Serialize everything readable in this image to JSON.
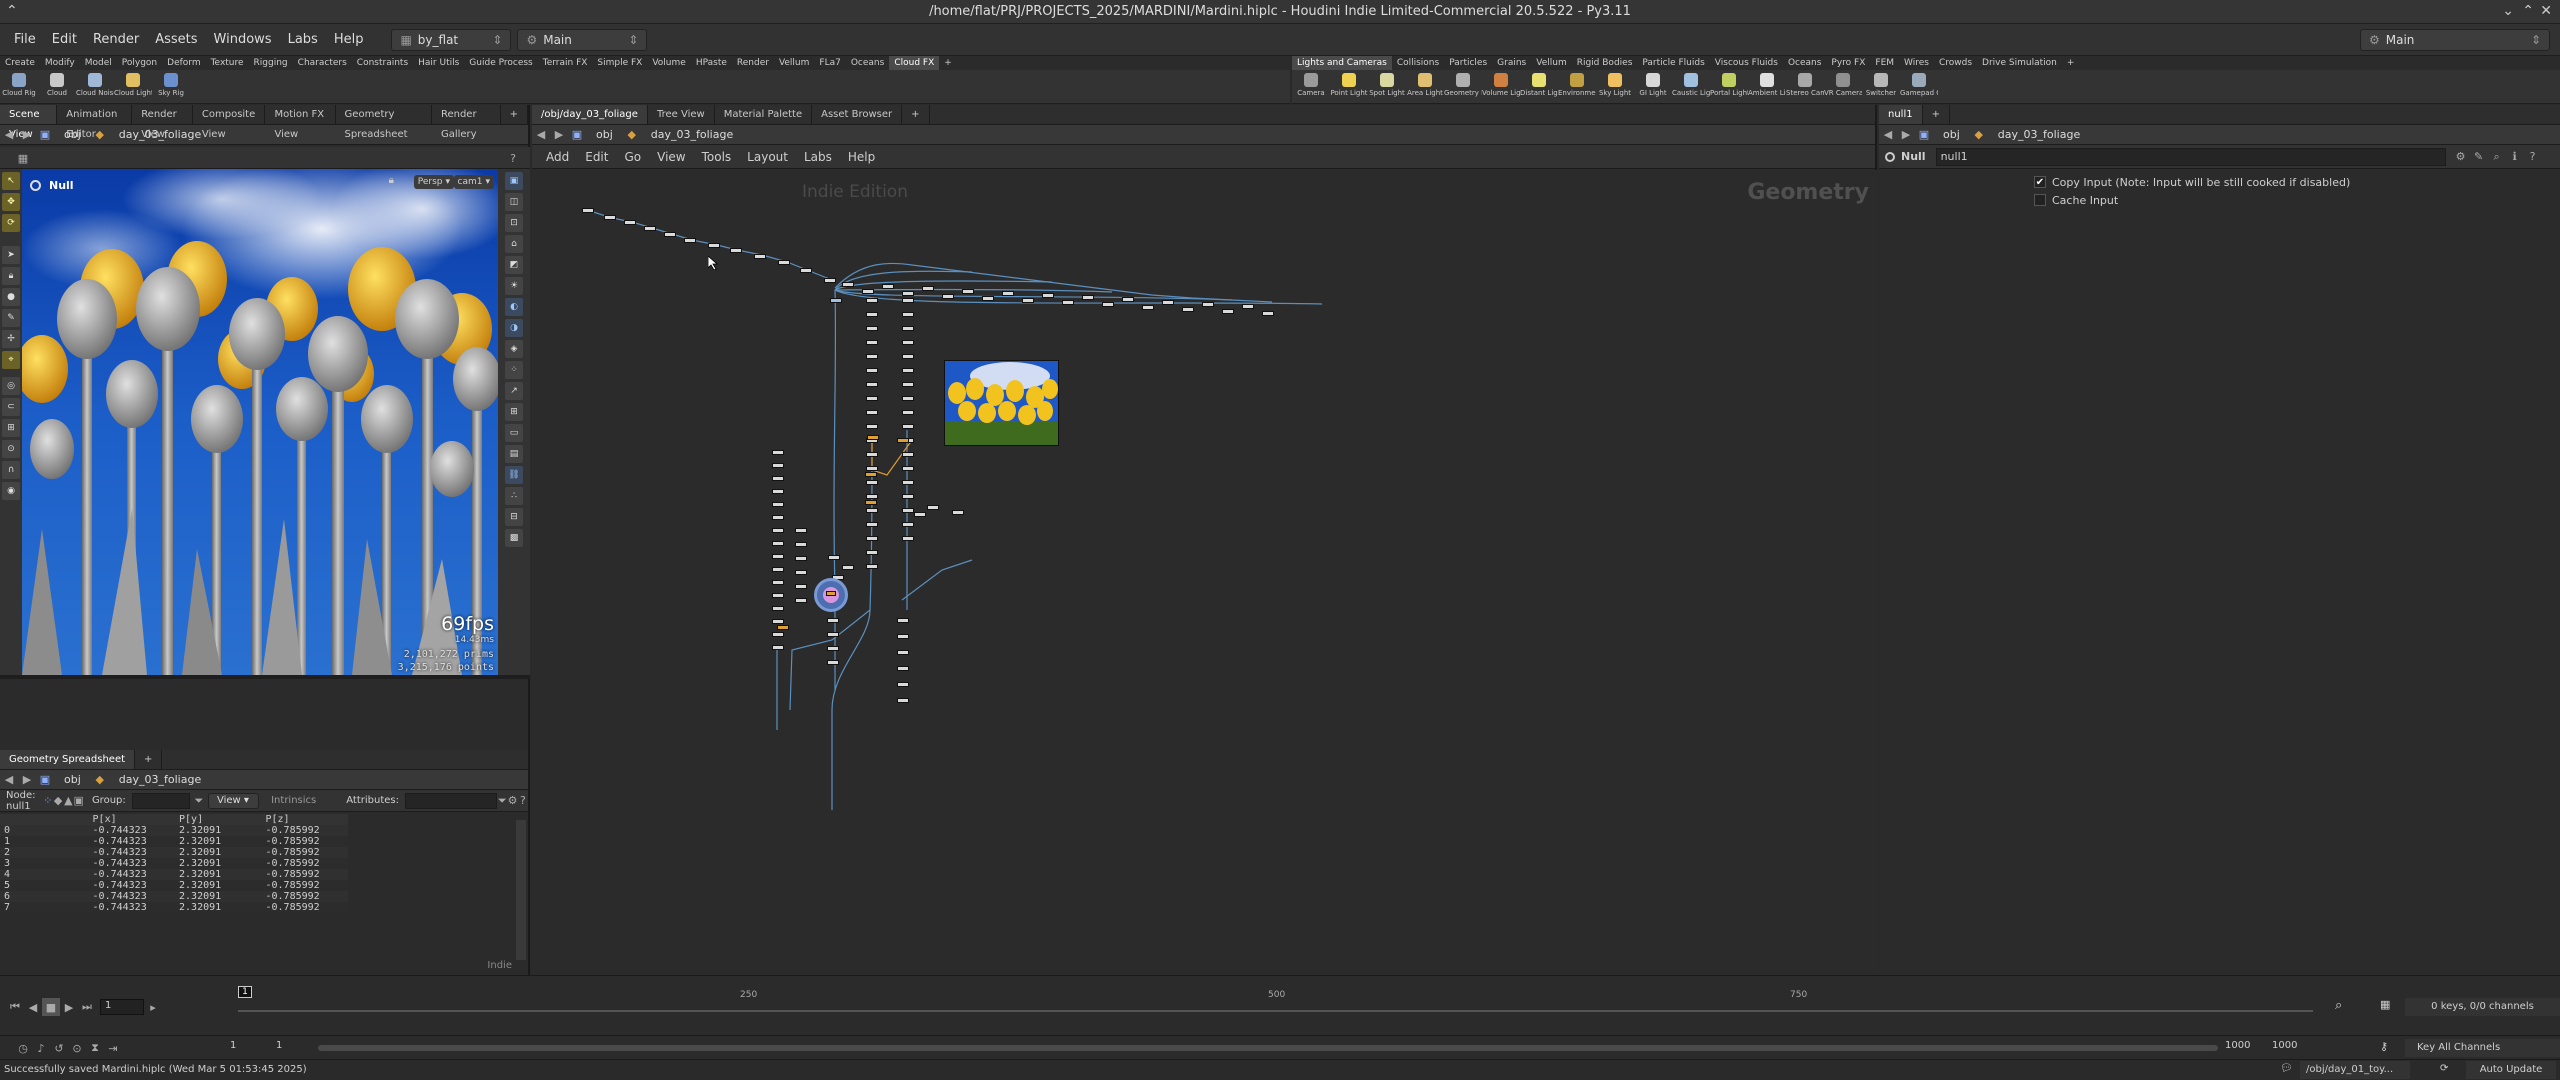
{
  "window": {
    "title": "/home/flat/PRJ/PROJECTS_2025/MARDINI/Mardini.hiplc - Houdini Indie Limited-Commercial 20.5.522 - Py3.11"
  },
  "menu": {
    "items": [
      "File",
      "Edit",
      "Render",
      "Assets",
      "Windows",
      "Labs",
      "Help"
    ],
    "desktop": "by_flat",
    "main_ctx": "Main",
    "right_ctx": "Main"
  },
  "shelf_left": {
    "tabs": [
      "Create",
      "Modify",
      "Model",
      "Polygon",
      "Deform",
      "Texture",
      "Rigging",
      "Characters",
      "Constraints",
      "Hair Utils",
      "Guide Process",
      "Terrain FX",
      "Simple FX",
      "Volume",
      "HPaste",
      "Render",
      "Vellum",
      "FLa7",
      "Oceans",
      "Cloud FX"
    ],
    "selected": "Cloud FX",
    "tools": [
      "Cloud Rig",
      "Cloud",
      "Cloud Noise",
      "Cloud Light",
      "Sky Rig"
    ]
  },
  "shelf_right": {
    "tabs": [
      "Lights and Cameras",
      "Collisions",
      "Particles",
      "Grains",
      "Vellum",
      "Rigid Bodies",
      "Particle Fluids",
      "Viscous Fluids",
      "Oceans",
      "Pyro FX",
      "FEM",
      "Wires",
      "Crowds",
      "Drive Simulation"
    ],
    "selected": "Lights and Cameras",
    "tools": [
      "Camera",
      "Point Light",
      "Spot Light",
      "Area Light",
      "Geometry Light",
      "Volume Light",
      "Distant Light",
      "Environment Light",
      "Sky Light",
      "GI Light",
      "Caustic Light",
      "Portal Light",
      "Ambient Light",
      "Stereo Camera",
      "VR Camera",
      "Switcher",
      "Gamepad Camera"
    ]
  },
  "scene_tabs": [
    "Scene View",
    "Animation Editor",
    "Render View",
    "Composite View",
    "Motion FX View",
    "Geometry Spreadsheet",
    "Render Gallery"
  ],
  "scene_path": {
    "root": "obj",
    "node": "day_03_foliage"
  },
  "viewport": {
    "node_label": "Null",
    "persp": "Persp",
    "cam": "cam1",
    "fps": "69fps",
    "ms": "14.43ms",
    "prims": "2,101,272  prims",
    "points": "3,215,176 points"
  },
  "spreadsheet": {
    "tab": "Geometry Spreadsheet",
    "path_root": "obj",
    "path_node": "day_03_foliage",
    "node_label": "Node: null1",
    "group_label": "Group:",
    "view_label": "View",
    "intrinsics_label": "Intrinsics",
    "attributes_label": "Attributes:",
    "columns": [
      "",
      "P[x]",
      "P[y]",
      "P[z]"
    ],
    "rows": [
      [
        "0",
        "-0.744323",
        "2.32091",
        "-0.785992"
      ],
      [
        "1",
        "-0.744323",
        "2.32091",
        "-0.785992"
      ],
      [
        "2",
        "-0.744323",
        "2.32091",
        "-0.785992"
      ],
      [
        "3",
        "-0.744323",
        "2.32091",
        "-0.785992"
      ],
      [
        "4",
        "-0.744323",
        "2.32091",
        "-0.785992"
      ],
      [
        "5",
        "-0.744323",
        "2.32091",
        "-0.785992"
      ],
      [
        "6",
        "-0.744323",
        "2.32091",
        "-0.785992"
      ],
      [
        "7",
        "-0.744323",
        "2.32091",
        "-0.785992"
      ]
    ],
    "indie": "Indie"
  },
  "network": {
    "tabs": [
      "/obj/day_03_foliage",
      "Tree View",
      "Material Palette",
      "Asset Browser"
    ],
    "path_root": "obj",
    "path_node": "day_03_foliage",
    "menu": [
      "Add",
      "Edit",
      "Go",
      "View",
      "Tools",
      "Layout",
      "Labs",
      "Help"
    ],
    "watermark": "Indie Edition",
    "context": "Geometry"
  },
  "params": {
    "tab": "null1",
    "path_root": "obj",
    "path_node": "day_03_foliage",
    "type": "Null",
    "name": "null1",
    "copy_input": "Copy Input (Note: Input will be still cooked if disabled)",
    "cache_input": "Cache Input"
  },
  "timeline": {
    "ticks": [
      "250",
      "500",
      "750"
    ],
    "frame": "1",
    "start": "1",
    "start2": "1",
    "end": "1000",
    "end2": "1000",
    "keys": "0 keys, 0/0 channels",
    "key_all": "Key All Channels",
    "marker": "1"
  },
  "status": {
    "message": "Successfully saved Mardini.hiplc (Wed Mar  5 01:53:45 2025)",
    "path": "/obj/day_01_toy...",
    "update": "Auto Update"
  }
}
